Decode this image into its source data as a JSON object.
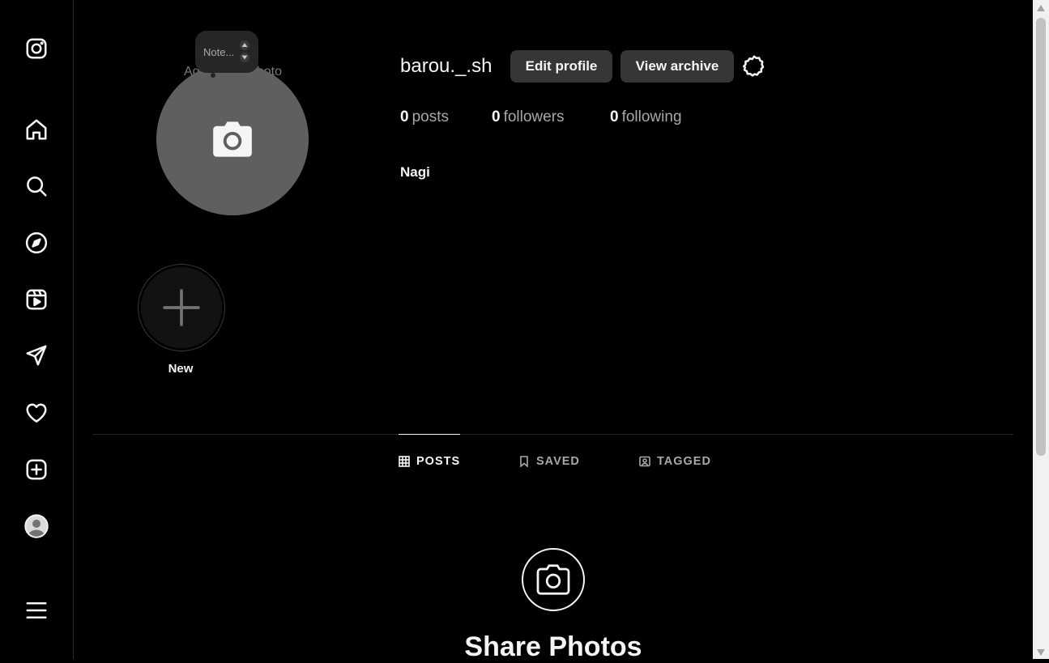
{
  "profile": {
    "username": "barou._.sh",
    "full_name": "Nagi",
    "avatar_hint": "Add profile photo",
    "note_placeholder": "Note...",
    "edit_label": "Edit profile",
    "archive_label": "View archive",
    "stats": {
      "posts_count": "0",
      "posts_label": "posts",
      "followers_count": "0",
      "followers_label": "followers",
      "following_count": "0",
      "following_label": "following"
    }
  },
  "highlights": {
    "new_label": "New"
  },
  "tabs": [
    {
      "label": "POSTS",
      "icon": "grid-icon",
      "active": true
    },
    {
      "label": "SAVED",
      "icon": "bookmark-icon",
      "active": false
    },
    {
      "label": "TAGGED",
      "icon": "tagged-icon",
      "active": false
    }
  ],
  "empty_state": {
    "title": "Share Photos"
  },
  "sidebar": {
    "items": [
      "instagram-icon",
      "home-icon",
      "search-icon",
      "explore-icon",
      "reels-icon",
      "messages-icon",
      "notifications-icon",
      "create-icon",
      "profile-avatar",
      "menu-icon"
    ]
  },
  "colors": {
    "background": "#000000",
    "button_bg": "#363636",
    "avatar_bg": "#5f5f5f",
    "muted_text": "#a8a8a8"
  }
}
